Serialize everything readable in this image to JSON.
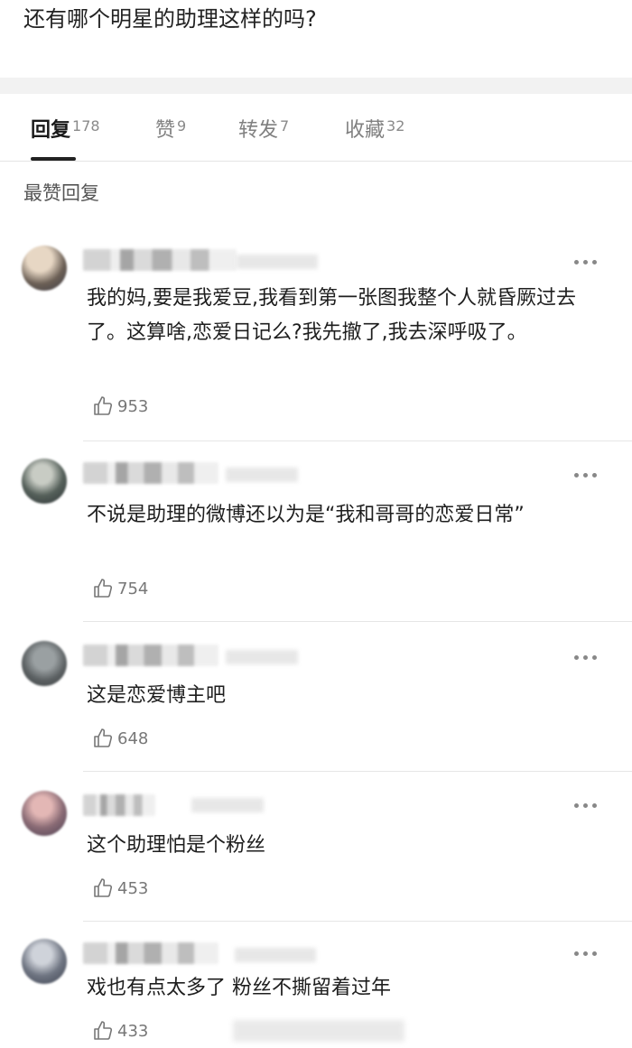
{
  "post": {
    "title": "还有哪个明星的助理这样的吗?"
  },
  "tabs": [
    {
      "label": "回复",
      "count": "178",
      "active": true
    },
    {
      "label": "赞",
      "count": "9"
    },
    {
      "label": "转发",
      "count": "7"
    },
    {
      "label": "收藏",
      "count": "32"
    }
  ],
  "section_title": "最赞回复",
  "comments": [
    {
      "text": "我的妈,要是我爱豆,我看到第一张图我整个人就昏厥过去了。这算啥,恋爱日记么?我先撤了,我去深呼吸了。",
      "likes": "953"
    },
    {
      "text": "不说是助理的微博还以为是“我和哥哥的恋爱日常”",
      "likes": "754"
    },
    {
      "text": "这是恋爱博主吧",
      "likes": "648"
    },
    {
      "text": "这个助理怕是个粉丝",
      "likes": "453"
    },
    {
      "text": "戏也有点太多了 粉丝不撕留着过年",
      "likes": "433"
    }
  ],
  "colors": {
    "divider": "#e6e6e6",
    "muted": "#808080",
    "text": "#1e1e1e",
    "active_underline": "#222222"
  },
  "icons": {
    "more": "more-dots-icon",
    "like": "thumbs-up-icon"
  }
}
